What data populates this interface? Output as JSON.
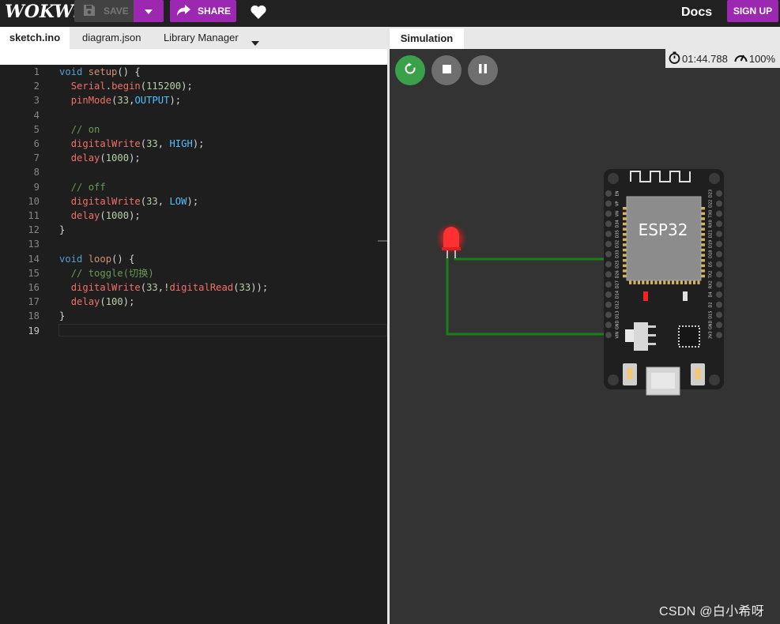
{
  "app": {
    "logo": "WOKWi"
  },
  "toolbar": {
    "save_label": "SAVE",
    "share_label": "SHARE",
    "docs_label": "Docs",
    "signup_label": "SIGN UP"
  },
  "editor_tabs": [
    {
      "label": "sketch.ino",
      "active": true
    },
    {
      "label": "diagram.json",
      "active": false
    },
    {
      "label": "Library Manager",
      "active": false
    }
  ],
  "code": {
    "lines": [
      [
        [
          "kw",
          "void"
        ],
        [
          "pun",
          " "
        ],
        [
          "fn",
          "setup"
        ],
        [
          "pun",
          "() {"
        ]
      ],
      [
        [
          "pun",
          "  "
        ],
        [
          "fnb",
          "Serial"
        ],
        [
          "pun",
          "."
        ],
        [
          "fnb",
          "begin"
        ],
        [
          "pun",
          "("
        ],
        [
          "num",
          "115200"
        ],
        [
          "pun",
          ");"
        ]
      ],
      [
        [
          "pun",
          "  "
        ],
        [
          "fnb",
          "pinMode"
        ],
        [
          "pun",
          "("
        ],
        [
          "num",
          "33"
        ],
        [
          "pun",
          ","
        ],
        [
          "cst",
          "OUTPUT"
        ],
        [
          "pun",
          ");"
        ]
      ],
      [],
      [
        [
          "pun",
          "  "
        ],
        [
          "cm",
          "// on"
        ]
      ],
      [
        [
          "pun",
          "  "
        ],
        [
          "fnb",
          "digitalWrite"
        ],
        [
          "pun",
          "("
        ],
        [
          "num",
          "33"
        ],
        [
          "pun",
          ", "
        ],
        [
          "cst",
          "HIGH"
        ],
        [
          "pun",
          ");"
        ]
      ],
      [
        [
          "pun",
          "  "
        ],
        [
          "fnb",
          "delay"
        ],
        [
          "pun",
          "("
        ],
        [
          "num",
          "1000"
        ],
        [
          "pun",
          ");"
        ]
      ],
      [],
      [
        [
          "pun",
          "  "
        ],
        [
          "cm",
          "// off"
        ]
      ],
      [
        [
          "pun",
          "  "
        ],
        [
          "fnb",
          "digitalWrite"
        ],
        [
          "pun",
          "("
        ],
        [
          "num",
          "33"
        ],
        [
          "pun",
          ", "
        ],
        [
          "cst",
          "LOW"
        ],
        [
          "pun",
          ");"
        ]
      ],
      [
        [
          "pun",
          "  "
        ],
        [
          "fnb",
          "delay"
        ],
        [
          "pun",
          "("
        ],
        [
          "num",
          "1000"
        ],
        [
          "pun",
          ");"
        ]
      ],
      [
        [
          "pun",
          "}"
        ]
      ],
      [],
      [
        [
          "kw",
          "void"
        ],
        [
          "pun",
          " "
        ],
        [
          "fn",
          "loop"
        ],
        [
          "pun",
          "() {"
        ]
      ],
      [
        [
          "pun",
          "  "
        ],
        [
          "cm",
          "// toggle(切换)"
        ]
      ],
      [
        [
          "pun",
          "  "
        ],
        [
          "fnb",
          "digitalWrite"
        ],
        [
          "pun",
          "("
        ],
        [
          "num",
          "33"
        ],
        [
          "pun",
          ",!"
        ],
        [
          "fnb",
          "digitalRead"
        ],
        [
          "pun",
          "("
        ],
        [
          "num",
          "33"
        ],
        [
          "pun",
          "));"
        ]
      ],
      [
        [
          "pun",
          "  "
        ],
        [
          "fnb",
          "delay"
        ],
        [
          "pun",
          "("
        ],
        [
          "num",
          "100"
        ],
        [
          "pun",
          ");"
        ]
      ],
      [
        [
          "pun",
          "}"
        ]
      ],
      []
    ],
    "active_line": 19
  },
  "simulation": {
    "tab_label": "Simulation",
    "timer": "01:44.788",
    "speed": "100%",
    "board_label": "ESP32",
    "pins_left": [
      "EN",
      "VP",
      "VN",
      "D34",
      "D35",
      "D32",
      "D33",
      "D25",
      "D26",
      "D27",
      "D14",
      "D12",
      "D13",
      "GND",
      "VIN"
    ],
    "pins_right": [
      "D23",
      "D22",
      "TX0",
      "RX0",
      "D21",
      "D19",
      "D18",
      "D5",
      "TX2",
      "RX2",
      "D4",
      "D2",
      "D15",
      "GND",
      "3V3"
    ]
  },
  "colors": {
    "accent": "#9c27b0",
    "wire": "#1a7f1a",
    "led": "#ff2a2a",
    "run": "#3aa04a"
  },
  "watermark": "CSDN @白小希呀"
}
